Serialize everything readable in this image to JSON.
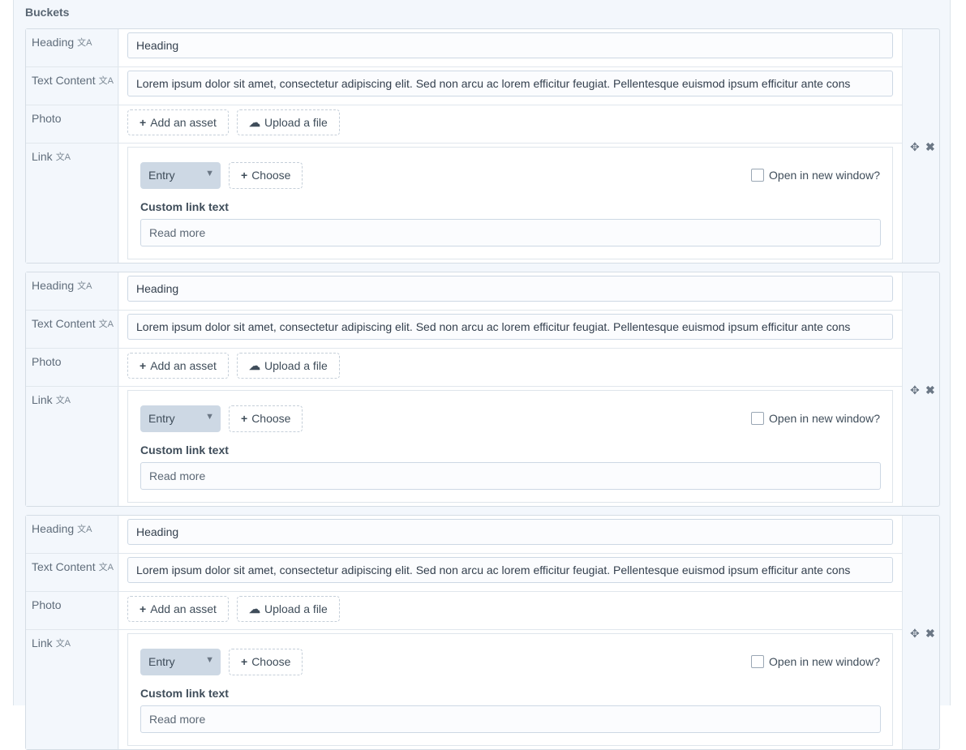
{
  "section_title": "Buckets",
  "translate_icon": "⁂",
  "blocks": [
    {
      "heading_label": "Heading",
      "heading_value": "Heading",
      "text_label": "Text Content",
      "text_value": "Lorem ipsum dolor sit amet, consectetur adipiscing elit.  Sed non arcu ac lorem efficitur feugiat. Pellentesque  euismod ipsum efficitur ante cons",
      "photo_label": "Photo",
      "add_asset": "Add an asset",
      "upload_file": "Upload a file",
      "link_label": "Link",
      "link_type": "Entry",
      "choose": "Choose",
      "new_window": "Open in new window?",
      "custom_link_label": "Custom link text",
      "custom_link_placeholder": "Read more"
    },
    {
      "heading_label": "Heading",
      "heading_value": "Heading",
      "text_label": "Text Content",
      "text_value": "Lorem ipsum dolor sit amet, consectetur adipiscing elit.  Sed non arcu ac lorem efficitur feugiat. Pellentesque  euismod ipsum efficitur ante cons",
      "photo_label": "Photo",
      "add_asset": "Add an asset",
      "upload_file": "Upload a file",
      "link_label": "Link",
      "link_type": "Entry",
      "choose": "Choose",
      "new_window": "Open in new window?",
      "custom_link_label": "Custom link text",
      "custom_link_placeholder": "Read more"
    },
    {
      "heading_label": "Heading",
      "heading_value": "Heading",
      "text_label": "Text Content",
      "text_value": "Lorem ipsum dolor sit amet, consectetur adipiscing elit.  Sed non arcu ac lorem efficitur feugiat. Pellentesque  euismod ipsum efficitur ante cons",
      "photo_label": "Photo",
      "add_asset": "Add an asset",
      "upload_file": "Upload a file",
      "link_label": "Link",
      "link_type": "Entry",
      "choose": "Choose",
      "new_window": "Open in new window?",
      "custom_link_label": "Custom link text",
      "custom_link_placeholder": "Read more"
    }
  ]
}
